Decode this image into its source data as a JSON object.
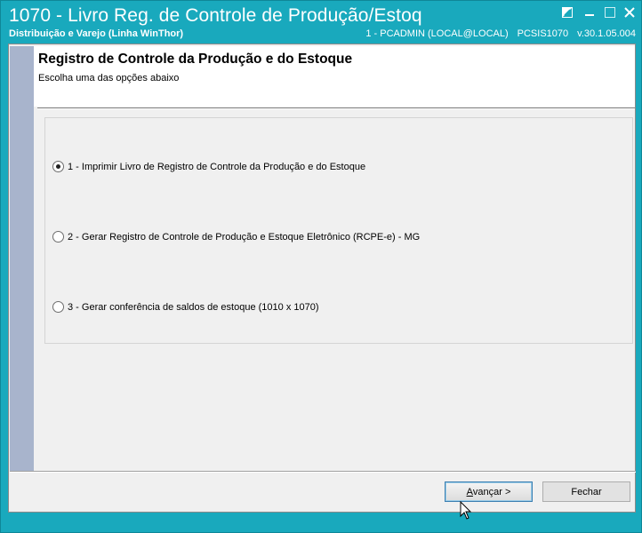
{
  "window": {
    "title": "1070 - Livro Reg. de Controle de Produção/Estoq",
    "subtitle": "Distribuição e Varejo (Linha WinThor)",
    "user": "1 - PCADMIN (LOCAL@LOCAL)",
    "module": "PCSIS1070",
    "version": "v.30.1.05.004",
    "controls": [
      "restore-icon",
      "minimize-icon",
      "maximize-icon",
      "close-icon"
    ]
  },
  "header": {
    "title": "Registro de Controle da Produção e do Estoque",
    "subtitle": "Escolha uma das opções abaixo"
  },
  "options": [
    {
      "label": "1 - Imprimir Livro de Registro de Controle da Produção e do Estoque",
      "selected": true
    },
    {
      "label": "2 - Gerar Registro de Controle de Produção e Estoque Eletrônico (RCPE-e) - MG",
      "selected": false
    },
    {
      "label": "3 - Gerar conferência de saldos de estoque (1010 x 1070)",
      "selected": false
    }
  ],
  "buttons": {
    "next_accel": "A",
    "next_rest": "vançar >",
    "close": "Fechar"
  },
  "colors": {
    "titlebar": "#19a9bd",
    "sidebar": "#a8b4cc",
    "panel": "#f0f0f0"
  }
}
